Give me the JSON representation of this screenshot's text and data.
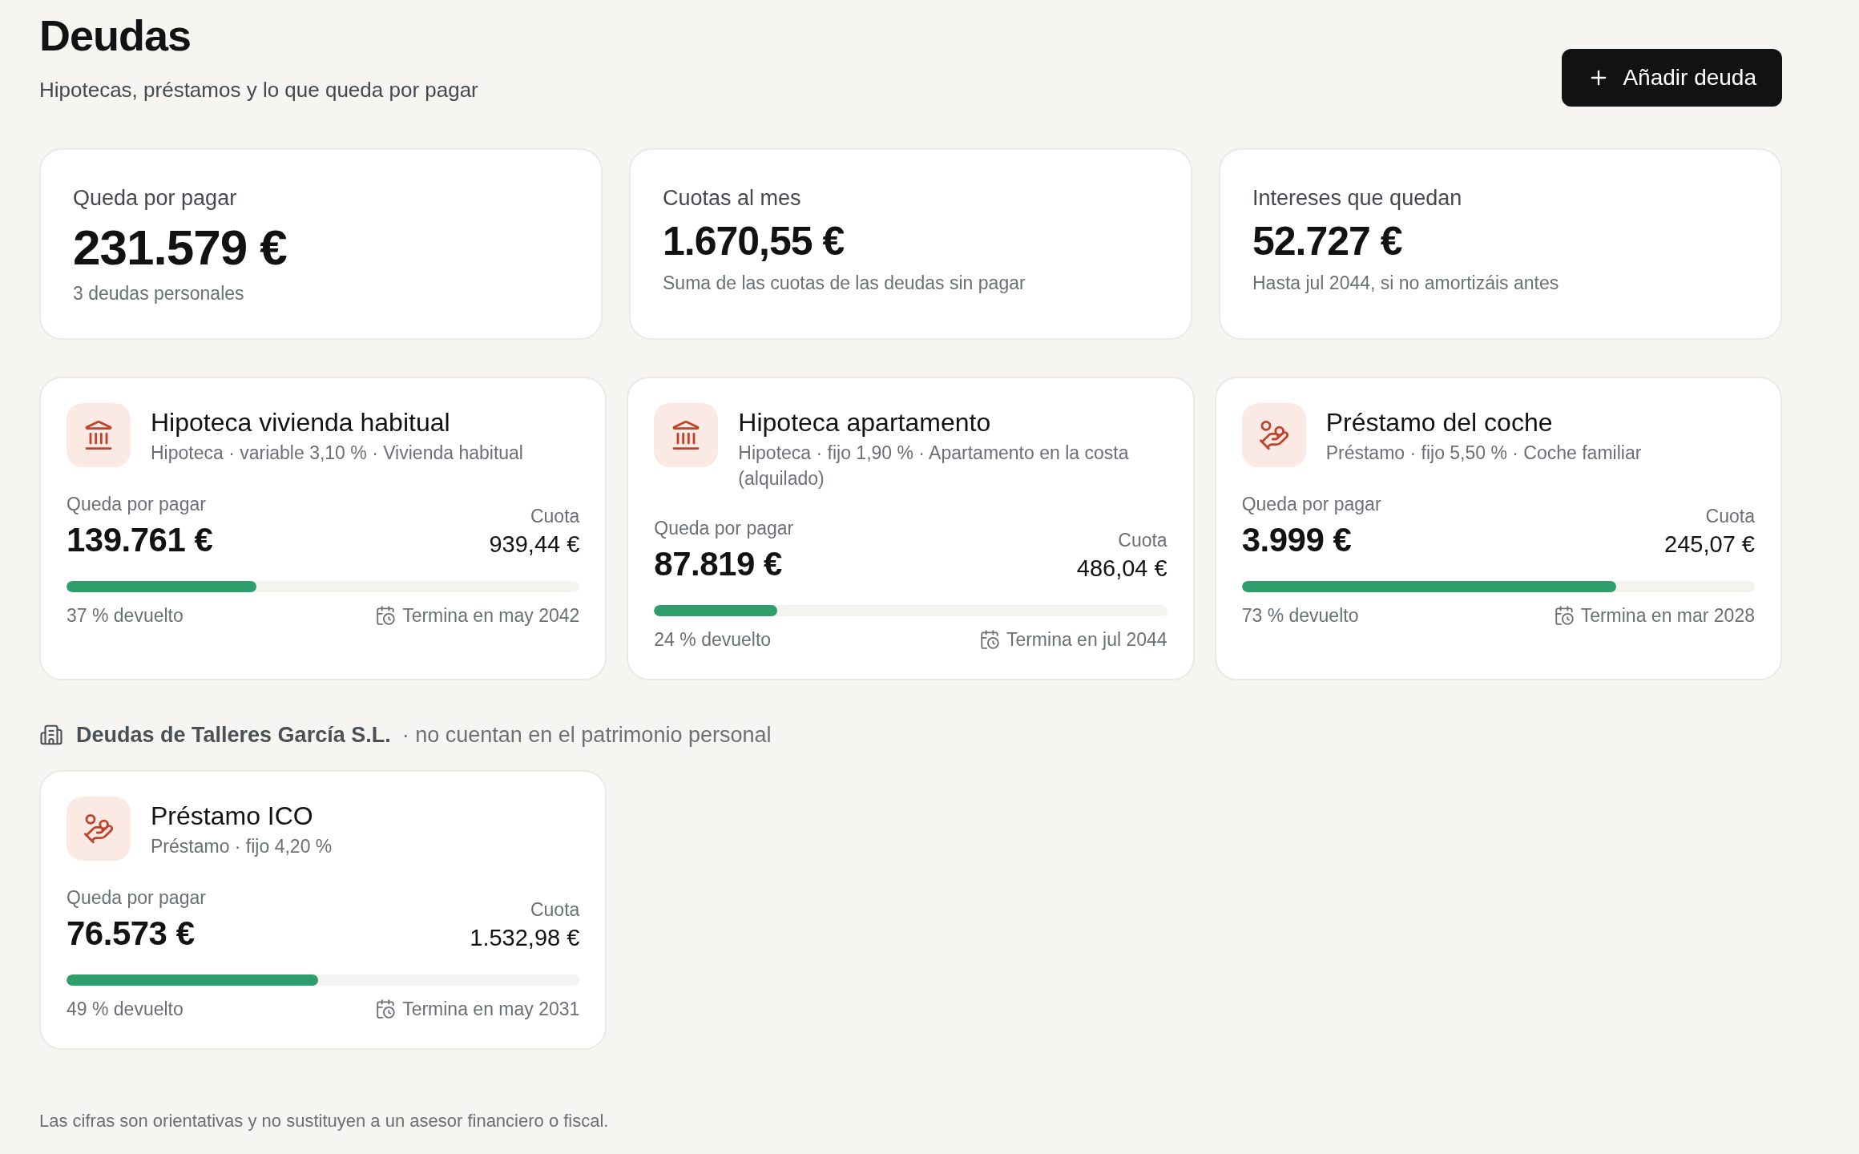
{
  "header": {
    "title": "Deudas",
    "subtitle": "Hipotecas, préstamos y lo que queda por pagar",
    "add_button": {
      "label": "Añadir deuda"
    }
  },
  "summary_cards": [
    {
      "kind": "primary",
      "label": "Queda por pagar",
      "value": "231.579 €",
      "note": "3 deudas personales"
    },
    {
      "kind": "secondary",
      "label": "Cuotas al mes",
      "value": "1.670,55 €",
      "note": "Suma de las cuotas de las deudas sin pagar"
    },
    {
      "kind": "secondary",
      "label": "Intereses que quedan",
      "value": "52.727 €",
      "note": "Hasta jul 2044, si no amortizáis antes"
    }
  ],
  "debts": [
    {
      "kind": "mortgage",
      "name": "Hipoteca vivienda habitual",
      "details": "Hipoteca · variable 3,10 % · Vivienda habitual",
      "remaining_label": "Queda por pagar",
      "remaining": "139.761 €",
      "payment_label": "Cuota",
      "payment": "939,44 €",
      "level": 0.37,
      "progress_text": "37 % devuelto",
      "end_text": "Termina en may 2042"
    },
    {
      "kind": "mortgage",
      "name": "Hipoteca apartamento",
      "details": "Hipoteca · fijo 1,90 % · Apartamento en la costa (alquilado)",
      "remaining_label": "Queda por pagar",
      "remaining": "87.819 €",
      "payment_label": "Cuota",
      "payment": "486,04 €",
      "level": 0.24,
      "progress_text": "24 % devuelto",
      "end_text": "Termina en jul 2044"
    },
    {
      "kind": "loan",
      "name": "Préstamo del coche",
      "details": "Préstamo · fijo 5,50 % · Coche familiar",
      "remaining_label": "Queda por pagar",
      "remaining": "3.999 €",
      "payment_label": "Cuota",
      "payment": "245,07 €",
      "level": 0.73,
      "progress_text": "73 % devuelto",
      "end_text": "Termina en mar 2028"
    }
  ],
  "business_section": {
    "title": "Deudas de Talleres García S.L.",
    "note": "· no cuentan en el patrimonio personal",
    "debts": [
      {
        "kind": "loan",
        "name": "Préstamo ICO",
        "details": "Préstamo · fijo 4,20 %",
        "remaining_label": "Queda por pagar",
        "remaining": "76.573 €",
        "payment_label": "Cuota",
        "payment": "1.532,98 €",
        "level": 0.49,
        "progress_text": "49 % devuelto",
        "end_text": "Termina en may 2031"
      }
    ]
  },
  "footer": {
    "disclaimer": "Las cifras son orientativas y no sustituyen a un asesor financiero o fiscal."
  }
}
